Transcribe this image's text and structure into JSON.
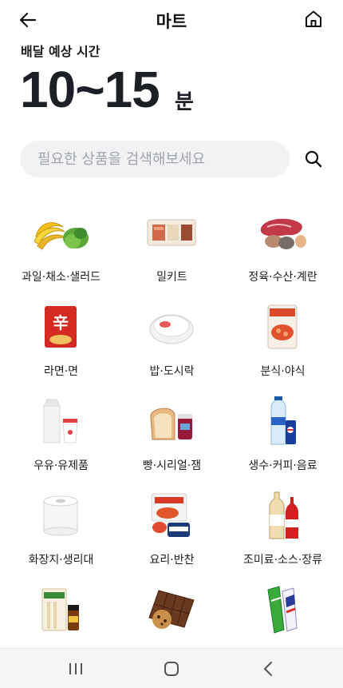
{
  "header": {
    "title": "마트"
  },
  "delivery": {
    "label": "배달 예상 시간",
    "value": "10~15",
    "unit": "분"
  },
  "search": {
    "placeholder": "필요한 상품을 검색해보세요"
  },
  "categories": [
    {
      "label": "과일·채소·샐러드",
      "icon": "fruit-vegetable-icon"
    },
    {
      "label": "밀키트",
      "icon": "meal-kit-icon"
    },
    {
      "label": "정육·수산·계란",
      "icon": "meat-seafood-icon"
    },
    {
      "label": "라면·면",
      "icon": "ramen-icon"
    },
    {
      "label": "밥·도시락",
      "icon": "rice-bowl-icon"
    },
    {
      "label": "분식·야식",
      "icon": "snack-food-icon"
    },
    {
      "label": "우유·유제품",
      "icon": "milk-icon"
    },
    {
      "label": "빵·시리얼·잼",
      "icon": "bread-icon"
    },
    {
      "label": "생수·커피·음료",
      "icon": "drinks-icon"
    },
    {
      "label": "화장지·생리대",
      "icon": "toilet-paper-icon"
    },
    {
      "label": "요리·반찬",
      "icon": "side-dish-icon"
    },
    {
      "label": "조미료·소스·장류",
      "icon": "sauce-icon"
    },
    {
      "label": "",
      "icon": "health-supplement-icon"
    },
    {
      "label": "",
      "icon": "chocolate-cookie-icon"
    },
    {
      "label": "",
      "icon": "ice-cream-icon"
    }
  ],
  "colors": {
    "text": "#1c1f26",
    "search_bg": "#f1f2f4",
    "placeholder": "#a1a5ab",
    "navbar_bg": "#f5f5f5"
  }
}
